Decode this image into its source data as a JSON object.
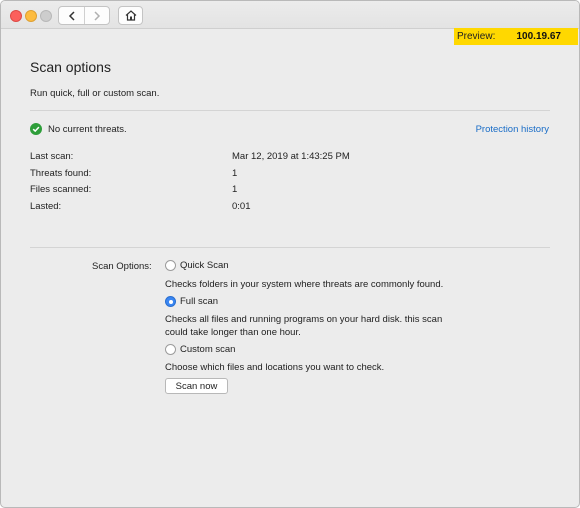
{
  "window": {
    "preview_label": "Preview:",
    "preview_value": "100.19.67"
  },
  "page": {
    "title": "Scan options",
    "subtitle": "Run quick, full or custom scan."
  },
  "status": {
    "text": "No current threats.",
    "icon": "check-circle-icon",
    "color": "#2e9e3a"
  },
  "protection_link": "Protection history",
  "scan_info": [
    {
      "label": "Last scan:",
      "value": "Mar 12, 2019 at 1:43:25 PM"
    },
    {
      "label": "Threats found:",
      "value": "1"
    },
    {
      "label": "Files scanned:",
      "value": "1"
    },
    {
      "label": "Lasted:",
      "value": "0:01"
    }
  ],
  "scan_options": {
    "label": "Scan Options:",
    "selected": "Full scan",
    "options": [
      {
        "label": "Quick Scan",
        "description": "Checks folders in your system where threats are commonly found."
      },
      {
        "label": "Full scan",
        "description": "Checks all files and running programs on your hard disk. this scan could take longer than one hour."
      },
      {
        "label": "Custom scan",
        "description": "Choose which files and locations you want to check."
      }
    ],
    "button": "Scan now"
  },
  "colors": {
    "accent": "#3a86f2",
    "link": "#1a6dc7",
    "preview_badge": "#ffd800"
  }
}
